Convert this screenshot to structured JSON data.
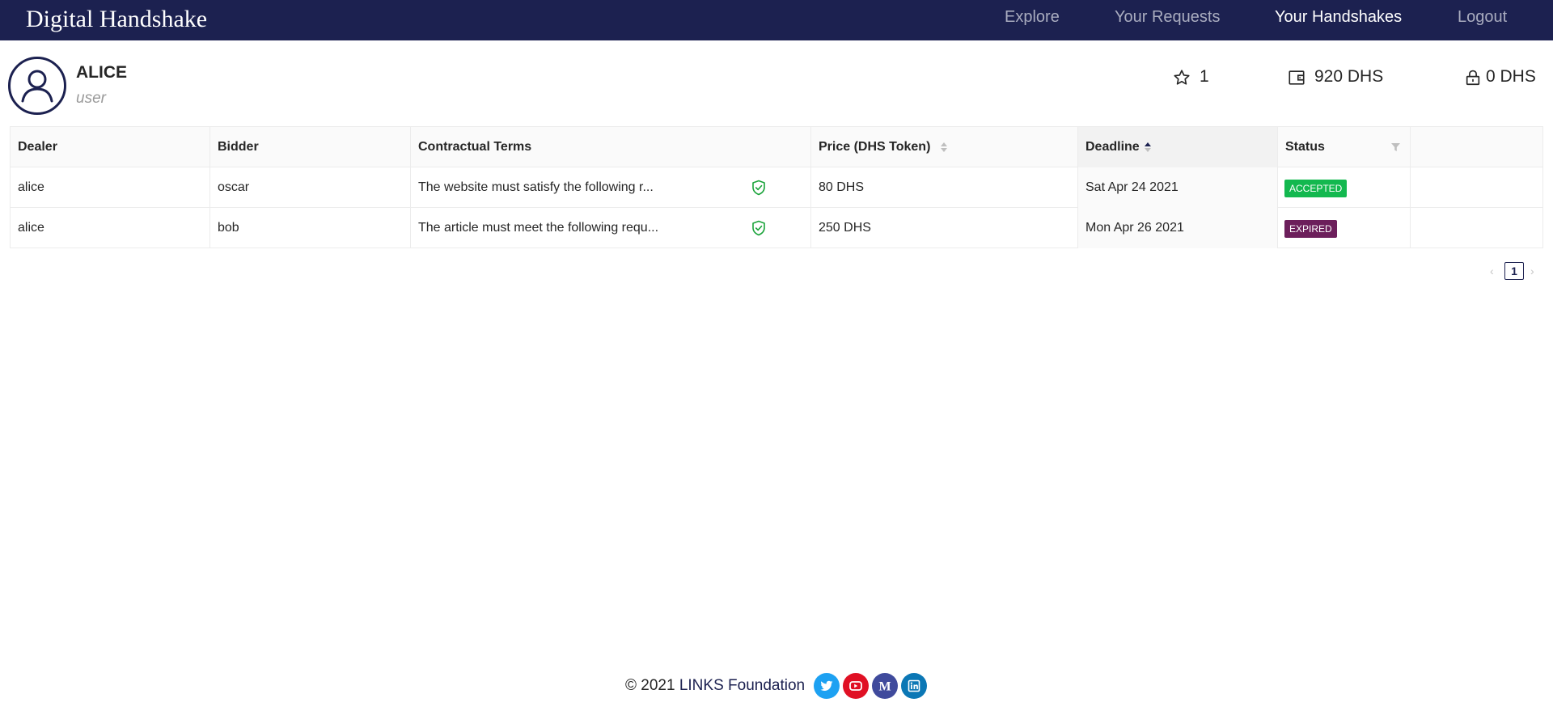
{
  "header": {
    "brand": "Digital Handshake",
    "nav": [
      {
        "label": "Explore",
        "active": false
      },
      {
        "label": "Your Requests",
        "active": false
      },
      {
        "label": "Your Handshakes",
        "active": true
      },
      {
        "label": "Logout",
        "active": false
      }
    ]
  },
  "user": {
    "name": "ALICE",
    "role": "user",
    "rating": "1",
    "balance": "920 DHS",
    "locked": "0 DHS"
  },
  "table": {
    "columns": [
      "Dealer",
      "Bidder",
      "Contractual Terms",
      "Price (DHS Token)",
      "Deadline",
      "Status"
    ],
    "sorted_column": "Deadline",
    "sort_direction": "ascending",
    "rows": [
      {
        "dealer": "alice",
        "bidder": "oscar",
        "terms": "The website must satisfy the following r...",
        "price": "80 DHS",
        "deadline": "Sat Apr 24 2021",
        "status": "ACCEPTED"
      },
      {
        "dealer": "alice",
        "bidder": "bob",
        "terms": "The article must meet the following requ...",
        "price": "250 DHS",
        "deadline": "Mon Apr 26 2021",
        "status": "EXPIRED"
      }
    ]
  },
  "pagination": {
    "current_page": "1",
    "prev": "‹",
    "next": "›"
  },
  "footer": {
    "copyright": "© 2021 ",
    "org": "LINKS Foundation",
    "social": [
      "twitter-icon",
      "youtube-icon",
      "medium-icon",
      "linkedin-icon"
    ]
  },
  "colors": {
    "navbar": "#1c2150",
    "accepted": "#13b84f",
    "expired": "#6c1f5b",
    "shield": "#1aa33a",
    "twitter": "#1da1f2",
    "youtube": "#e01024",
    "medium": "#3f4a9c",
    "linkedin": "#0b77b5"
  }
}
